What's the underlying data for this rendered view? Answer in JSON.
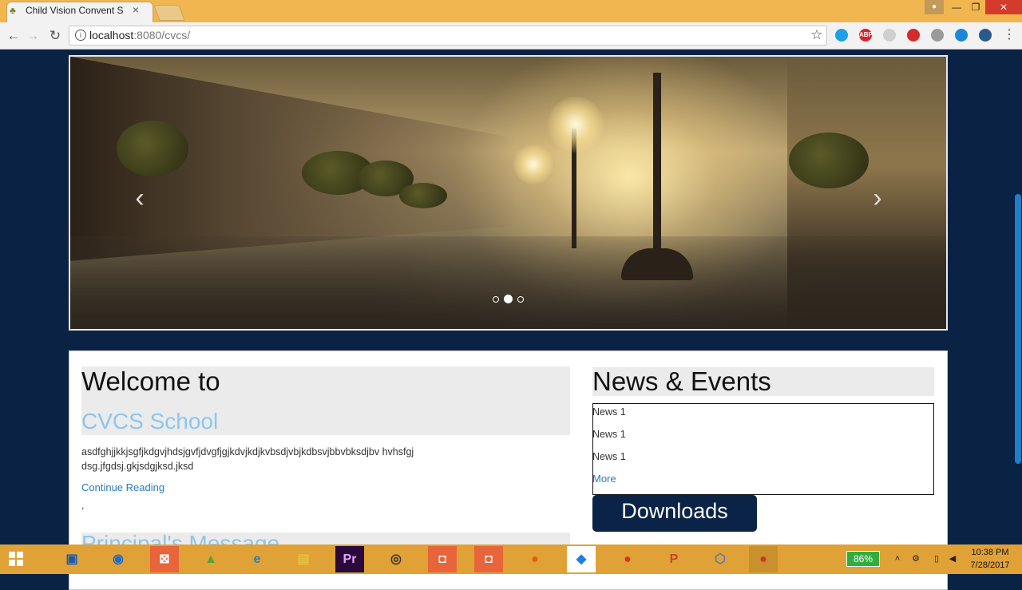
{
  "browser": {
    "tab_title": "Child Vision Convent Sch",
    "tab_close": "×",
    "url_host": "localhost",
    "url_rest": ":8080/cvcs/",
    "extensions": [
      {
        "name": "extension-blue-icon",
        "label": "",
        "color": "#1ea0e6"
      },
      {
        "name": "adblock-plus-icon",
        "label": "ABP",
        "color": "#d8232a"
      },
      {
        "name": "cube-extension-icon",
        "label": "",
        "color": "#cfcfcf"
      },
      {
        "name": "red-extension-icon",
        "label": "",
        "color": "#d62a2a"
      },
      {
        "name": "grey-extension-icon",
        "label": "",
        "color": "#9a9a9a"
      },
      {
        "name": "pocket-extension-icon",
        "label": "",
        "color": "#1e88d8"
      },
      {
        "name": "dark-extension-icon",
        "label": "",
        "color": "#2a5a8a"
      }
    ]
  },
  "window": {
    "minimize": "—",
    "maximize": "❐",
    "close": "✕"
  },
  "carousel": {
    "prev": "‹",
    "next": "›",
    "active_slide": 2,
    "slide_count": 3
  },
  "welcome": {
    "heading": "Welcome to",
    "school_name": "CVCS School",
    "text": "asdfghjjkkjsgfjkdgvjhdsjgvfjdvgfjgjkdvjkdjkvbsdjvbjkdbsvjbbvbksdjbv hvhsfgjdsg.jfgdsj.gkjsdgjksd.jksd",
    "continue_link": "Continue Reading",
    "stray": ",",
    "principal_heading": "Principal's Message"
  },
  "news": {
    "heading": "News & Events",
    "items": [
      "News 1",
      "News 1",
      "News 1"
    ],
    "more": "More",
    "downloads": "Downloads"
  },
  "taskbar": {
    "battery": "86%",
    "time": "10:38 PM",
    "date": "7/28/2017"
  },
  "colors": {
    "page_bg": "#0a2244",
    "accent_link": "#2a7ab8",
    "light_blue_heading": "#8ec6ec",
    "taskbar": "#e0a236",
    "titlebar": "#f1b64f"
  }
}
